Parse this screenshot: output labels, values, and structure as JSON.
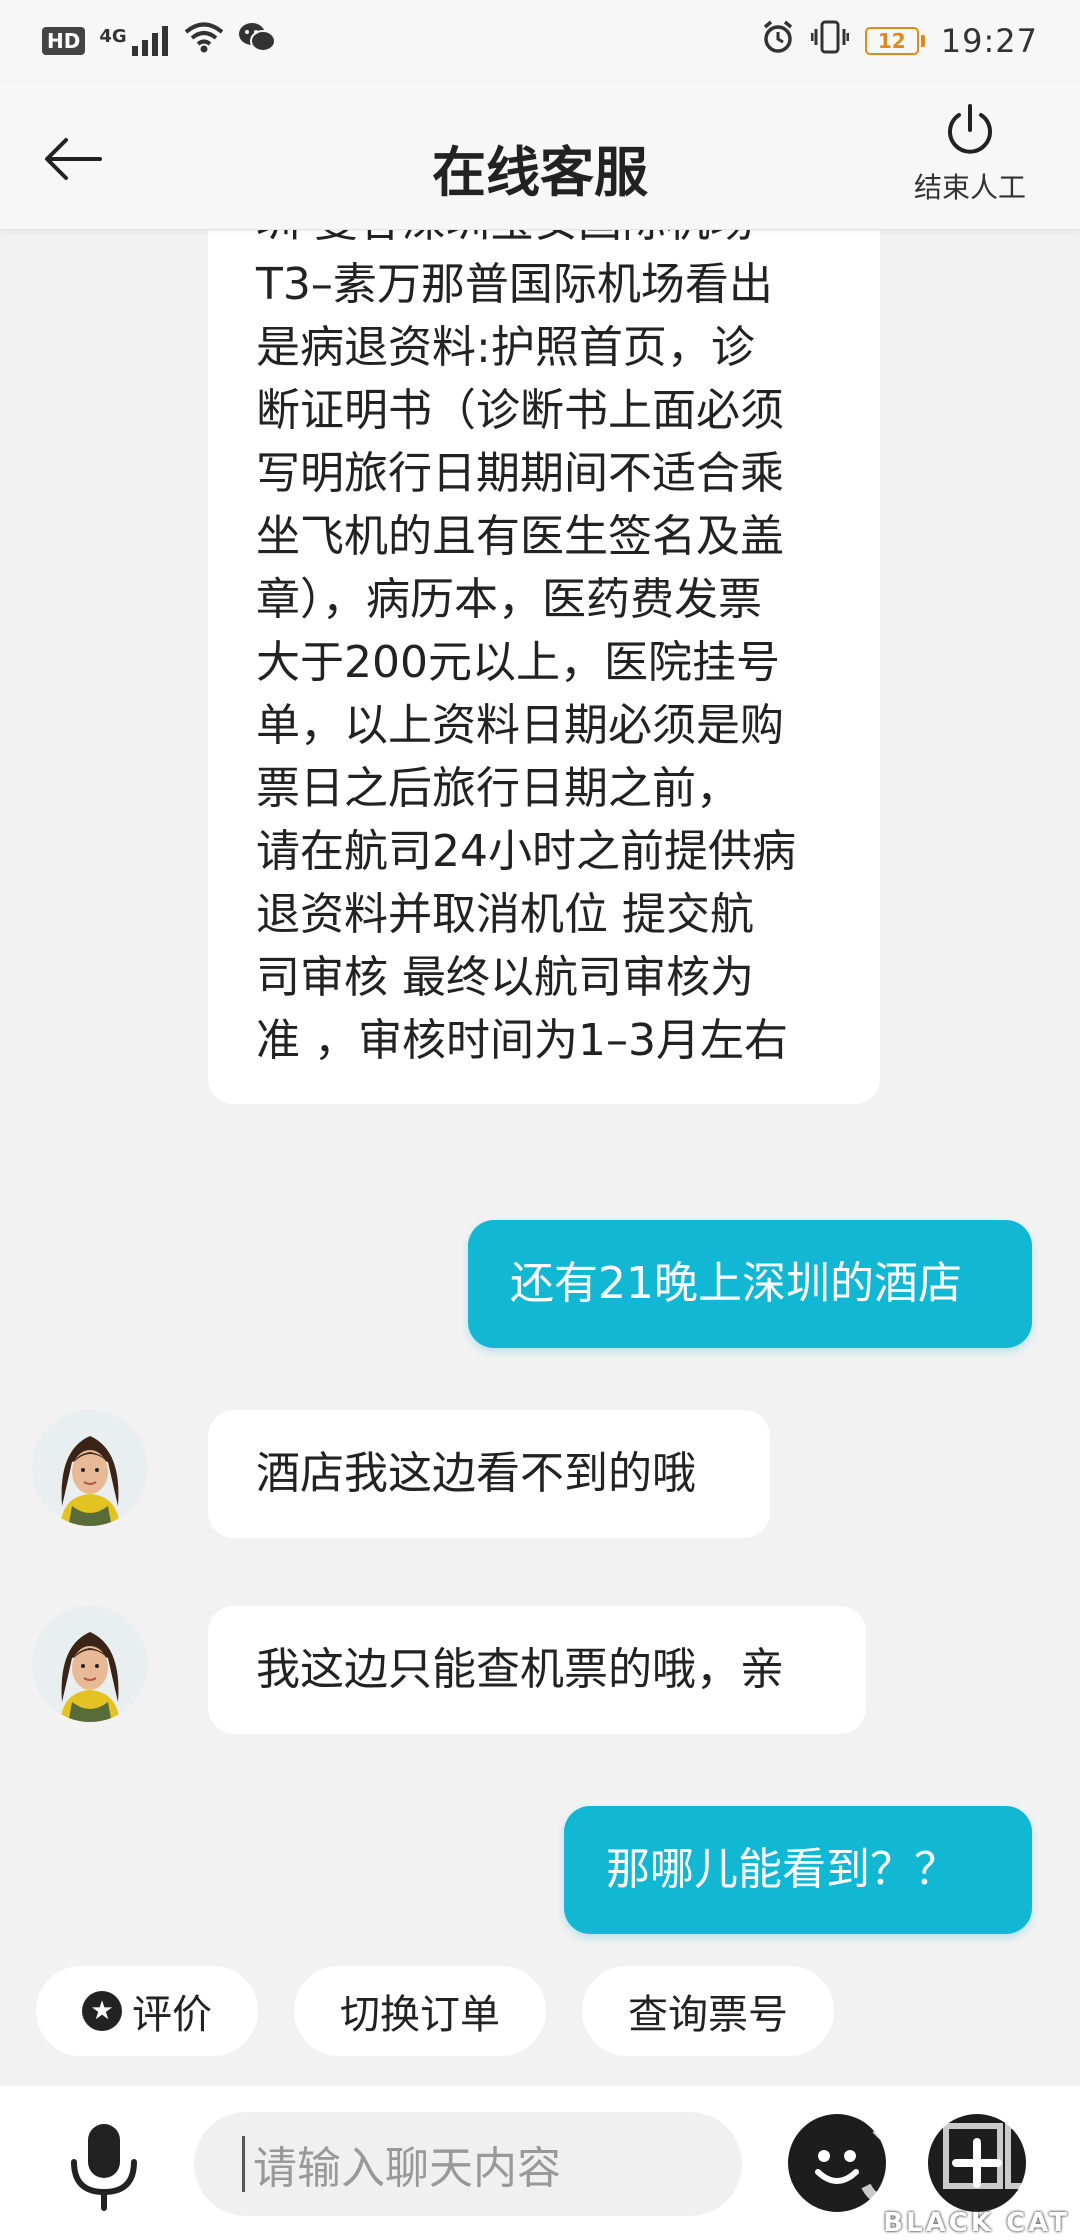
{
  "status_bar": {
    "hd": "HD",
    "network": "4G",
    "battery": "12",
    "time": "19:27"
  },
  "header": {
    "title": "在线客服",
    "end_label": "结束人工"
  },
  "messages": [
    {
      "side": "left",
      "lines": [
        "圳 曼谷深圳宝安国际机场",
        "T3–素万那普国际机场看出",
        "是病退资料:护照首页，诊",
        "断证明书（诊断书上面必须",
        "写明旅行日期期间不适合乘",
        "坐飞机的且有医生签名及盖",
        "章），病历本，医药费发票",
        "大于200元以上，医院挂号",
        "单，以上资料日期必须是购",
        "票日之后旅行日期之前，",
        "请在航司24小时之前提供病",
        "退资料并取消机位  提交航",
        "司审核  最终以航司审核为",
        "准  ，审核时间为1–3月左右"
      ]
    },
    {
      "side": "right",
      "text": "还有21晚上深圳的酒店"
    },
    {
      "side": "left",
      "text": "酒店我这边看不到的哦"
    },
    {
      "side": "left",
      "text": "我这边只能查机票的哦，亲"
    },
    {
      "side": "right",
      "text": "那哪儿能看到？？"
    }
  ],
  "quick_actions": [
    {
      "label": "评价",
      "icon": "star-icon"
    },
    {
      "label": "切换订单"
    },
    {
      "label": "查询票号"
    }
  ],
  "input": {
    "placeholder": "请输入聊天内容"
  },
  "watermark": {
    "text": "BLACK CAT"
  },
  "colors": {
    "accent": "#12b7d4",
    "background": "#f2f2f2",
    "bubble_left": "#ffffff"
  }
}
